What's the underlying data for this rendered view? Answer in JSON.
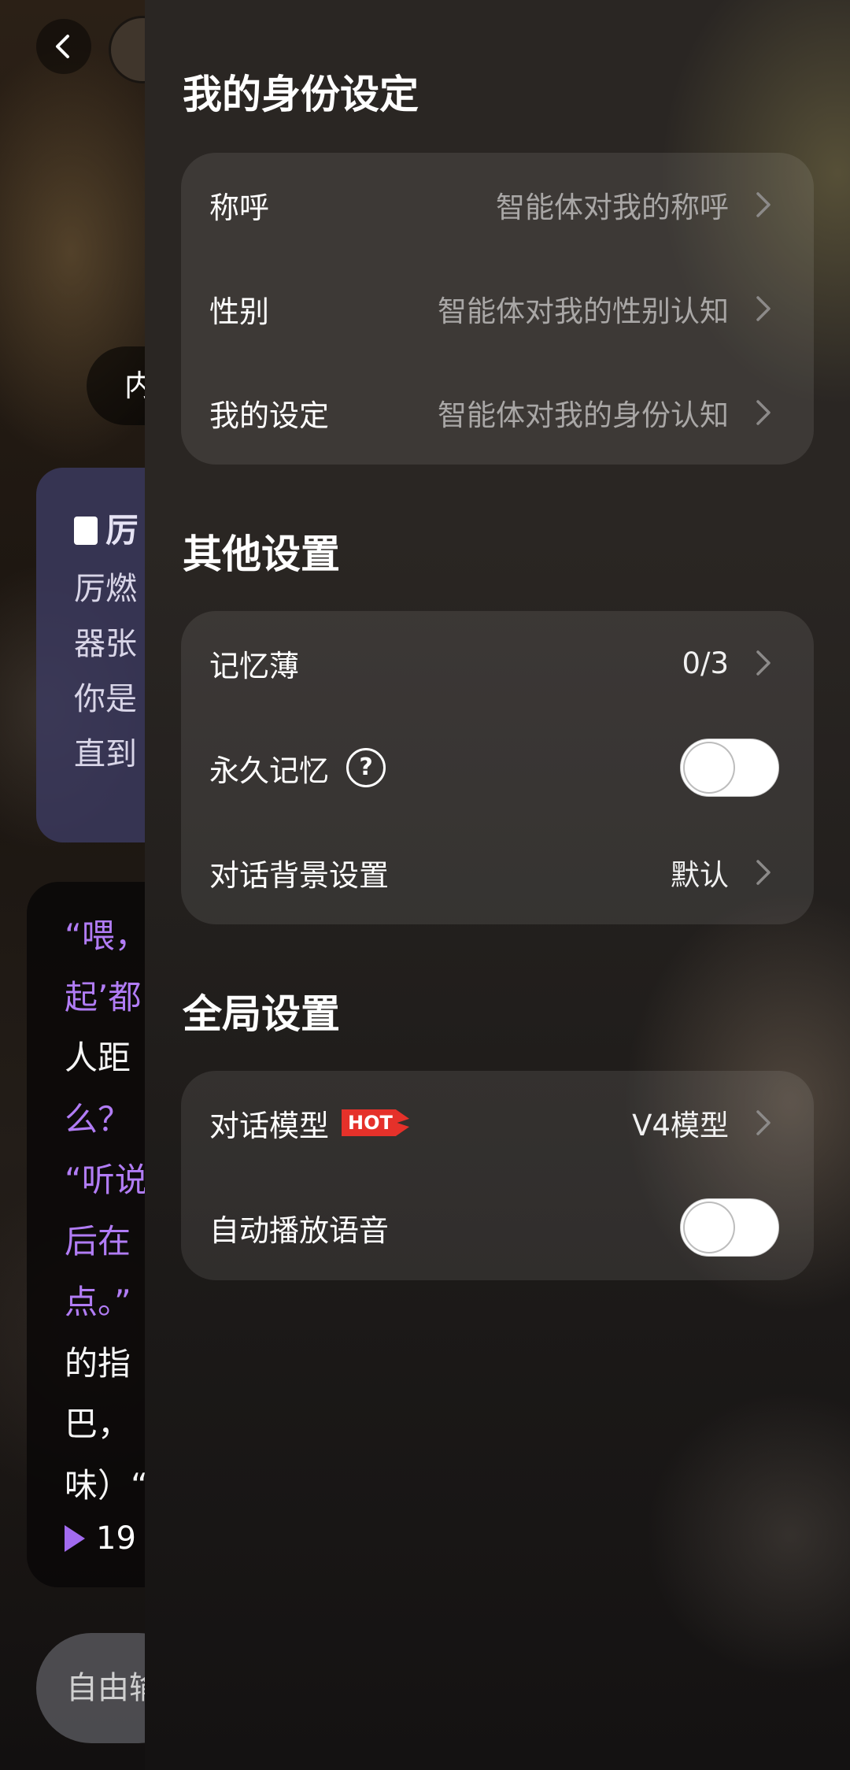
{
  "background": {
    "intro_chip_text": "内",
    "intro_card": {
      "title": "厉",
      "lines": [
        "厉燃",
        "器张",
        "你是",
        "直到"
      ]
    },
    "chat": {
      "lines": [
        {
          "text": "“喂，",
          "color": "purple"
        },
        {
          "text": "起’都",
          "color": "purple"
        },
        {
          "text": "人距",
          "color": "white"
        },
        {
          "text": "么？",
          "color": "purple"
        },
        {
          "text": "“听说",
          "color": "purple"
        },
        {
          "text": "后在",
          "color": "purple"
        },
        {
          "text": "点。”",
          "color": "purple"
        },
        {
          "text": "的指",
          "color": "white"
        },
        {
          "text": "巴，",
          "color": "white"
        },
        {
          "text": "味）“",
          "color": "white"
        }
      ],
      "duration_label": "19"
    },
    "input_placeholder": "自由输"
  },
  "drawer": {
    "identity": {
      "title": "我的身份设定",
      "rows": [
        {
          "label": "称呼",
          "value": "智能体对我的称呼"
        },
        {
          "label": "性别",
          "value": "智能体对我的性别认知"
        },
        {
          "label": "我的设定",
          "value": "智能体对我的身份认知"
        }
      ]
    },
    "other": {
      "title": "其他设置",
      "memo": {
        "label": "记忆薄",
        "value": "0/3"
      },
      "permanent_memory": {
        "label": "永久记忆",
        "help": "?",
        "enabled": false
      },
      "background": {
        "label": "对话背景设置",
        "value": "默认"
      }
    },
    "global": {
      "title": "全局设置",
      "model": {
        "label": "对话模型",
        "badge": "HOT",
        "value": "V4模型"
      },
      "auto_voice": {
        "label": "自动播放语音",
        "enabled": false
      }
    }
  },
  "colors": {
    "accent_purple": "#b17cf5",
    "hot_badge": "#e5312a"
  }
}
